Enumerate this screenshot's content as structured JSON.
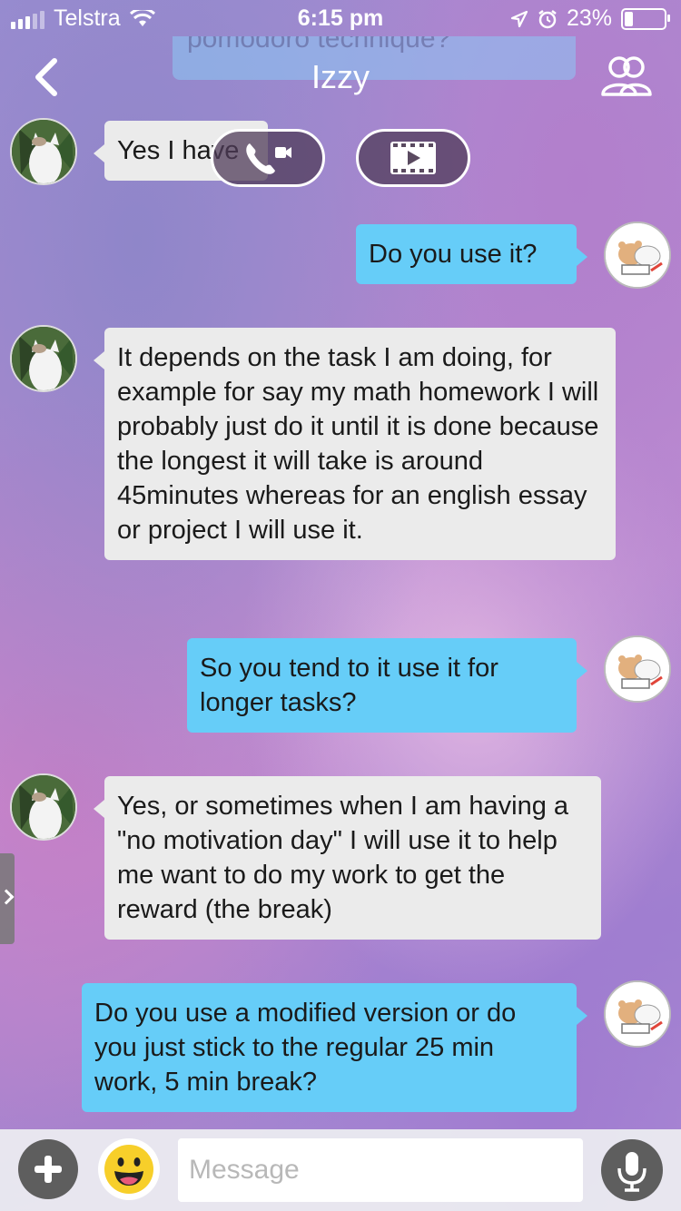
{
  "status_bar": {
    "carrier": "Telstra",
    "time": "6:15 pm",
    "battery": "23%",
    "battery_level": 0.23
  },
  "header": {
    "title": "Izzy",
    "pinned_preview": "pomodoro technique?",
    "back_icon": "chevron-left-icon",
    "members_icon": "users-icon"
  },
  "call_buttons": {
    "voice_icon": "phone-video-icon",
    "video_icon": "film-play-icon"
  },
  "messages": [
    {
      "sender": "Izzy",
      "direction": "in",
      "text": "Yes I have"
    },
    {
      "sender": "me",
      "direction": "out",
      "text": "Do you use it?"
    },
    {
      "sender": "Izzy",
      "direction": "in",
      "text": "It depends on the task I am doing, for example for say my math homework I will probably just do it until it is done because the longest it will take is around 45minutes whereas for an english essay or project I will use it."
    },
    {
      "sender": "me",
      "direction": "out",
      "text": "So you tend to it use it for longer tasks?"
    },
    {
      "sender": "Izzy",
      "direction": "in",
      "text": "Yes, or sometimes when I am having a \"no motivation day\" I will use it to help me want to do my work to get the reward (the break)"
    },
    {
      "sender": "me",
      "direction": "out",
      "text": "Do you use a modified version or do you just stick to the regular 25 min work, 5 min break?"
    }
  ],
  "input": {
    "placeholder": "Message",
    "value": ""
  },
  "colors": {
    "incoming_bubble": "#ebebeb",
    "outgoing_bubble": "#66cdf8",
    "input_bar": "#ebebf0"
  }
}
